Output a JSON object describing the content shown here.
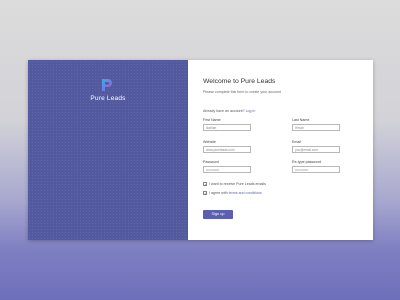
{
  "brand": {
    "name": "Pure Leads",
    "logo_icon": "P-logo-icon",
    "gradient_start": "#2fb0e6",
    "gradient_end": "#b84ad8"
  },
  "form": {
    "title": "Welcome to Pure Leads",
    "subtitle": "Please complete this form to create your account",
    "account_prompt": "Already have an account?",
    "login_link": "Log in",
    "fields": [
      {
        "label": "First Name",
        "value": "Nathan"
      },
      {
        "label": "Last Name",
        "value": "Hirsch"
      },
      {
        "label": "Website",
        "value": "www.pureleads.com"
      },
      {
        "label": "Email",
        "value": "you@email.com"
      },
      {
        "label": "Password",
        "value": "••••••••••••"
      },
      {
        "label": "Re-type password",
        "value": "••••••••••••"
      }
    ],
    "checkboxes": [
      {
        "label": "I want to receive Pure Leads emails",
        "checked": true
      },
      {
        "label": "I agree with",
        "link": "terms and conditions",
        "checked": true
      }
    ],
    "submit_label": "Sign up"
  },
  "colors": {
    "accent": "#5b5fb0",
    "panel": "#545aa0"
  }
}
